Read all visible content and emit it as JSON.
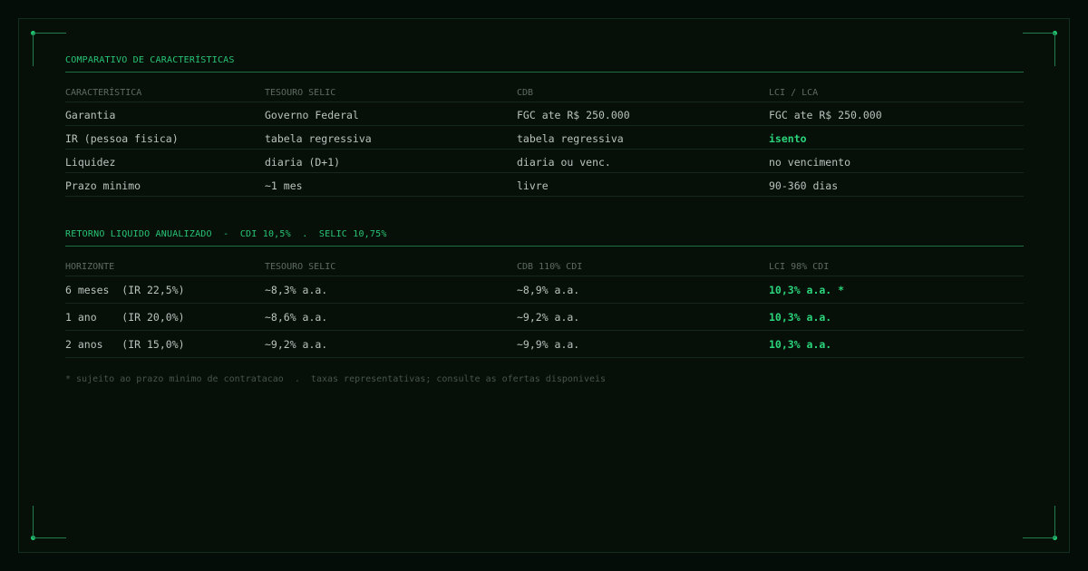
{
  "colors": {
    "background": "#050d08",
    "accent": "#2bd47a",
    "text": "#b9c2bd",
    "muted": "#5d6b63"
  },
  "comparison": {
    "title": "COMPARATIVO DE CARACTERÍSTICAS",
    "headers": [
      "CARACTERÍSTICA",
      "TESOURO SELIC",
      "CDB",
      "LCI / LCA"
    ],
    "rows": [
      [
        "Garantia",
        "Governo Federal",
        "FGC ate R$ 250.000",
        "FGC ate R$ 250.000"
      ],
      [
        "IR (pessoa fisica)",
        "tabela regressiva",
        "tabela regressiva",
        "isento"
      ],
      [
        "Liquidez",
        "diaria (D+1)",
        "diaria ou venc.",
        "no vencimento"
      ],
      [
        "Prazo minimo",
        "~1 mes",
        "livre",
        "90-360 dias"
      ]
    ]
  },
  "returns": {
    "title": "RETORNO LIQUIDO ANUALIZADO  -  CDI 10,5%  .  SELIC 10,75%",
    "headers": [
      "HORIZONTE",
      "TESOURO SELIC",
      "CDB 110% CDI",
      "LCI 98% CDI"
    ],
    "rows": [
      [
        "6 meses  (IR 22,5%)",
        "~8,3% a.a.",
        "~8,9% a.a.",
        "10,3% a.a. *"
      ],
      [
        "1 ano    (IR 20,0%)",
        "~8,6% a.a.",
        "~9,2% a.a.",
        "10,3% a.a."
      ],
      [
        "2 anos   (IR 15,0%)",
        "~9,2% a.a.",
        "~9,9% a.a.",
        "10,3% a.a."
      ]
    ]
  },
  "footnote": "* sujeito ao prazo minimo de contratacao  .  taxas representativas; consulte as ofertas disponiveis"
}
